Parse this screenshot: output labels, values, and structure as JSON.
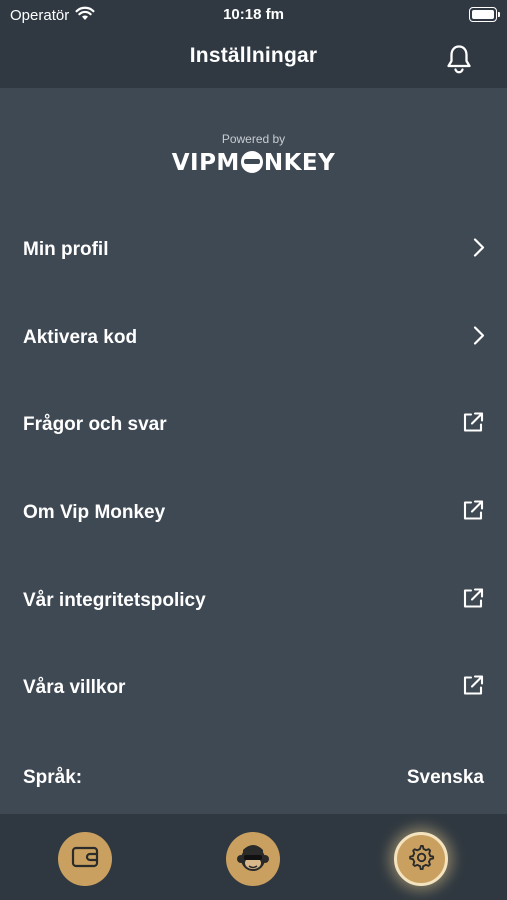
{
  "status_bar": {
    "carrier": "Operatör",
    "time": "10:18 fm",
    "battery_level": 1.0
  },
  "header": {
    "title": "Inställningar",
    "notification_icon": "bell-icon"
  },
  "branding": {
    "powered_by": "Powered by",
    "logo_text": "VIPMONKEY"
  },
  "menu": {
    "items": [
      {
        "label": "Min profil",
        "icon": "chevron-right-icon"
      },
      {
        "label": "Aktivera kod",
        "icon": "chevron-right-icon"
      },
      {
        "label": "Frågor och svar",
        "icon": "external-link-icon"
      },
      {
        "label": "Om Vip Monkey",
        "icon": "external-link-icon"
      },
      {
        "label": "Vår integritetspolicy",
        "icon": "external-link-icon"
      },
      {
        "label": "Våra villkor",
        "icon": "external-link-icon"
      }
    ]
  },
  "language": {
    "label": "Språk:",
    "value": "Svenska"
  },
  "tab_bar": {
    "tabs": [
      {
        "icon": "wallet-icon",
        "active": false
      },
      {
        "icon": "monkey-avatar-icon",
        "active": false
      },
      {
        "icon": "gear-icon",
        "active": true
      }
    ]
  },
  "colors": {
    "background": "#3f4953",
    "header_background": "#303942",
    "tab_bar_background": "#2f3840",
    "accent_gold": "#c9a060",
    "text": "#ffffff"
  }
}
